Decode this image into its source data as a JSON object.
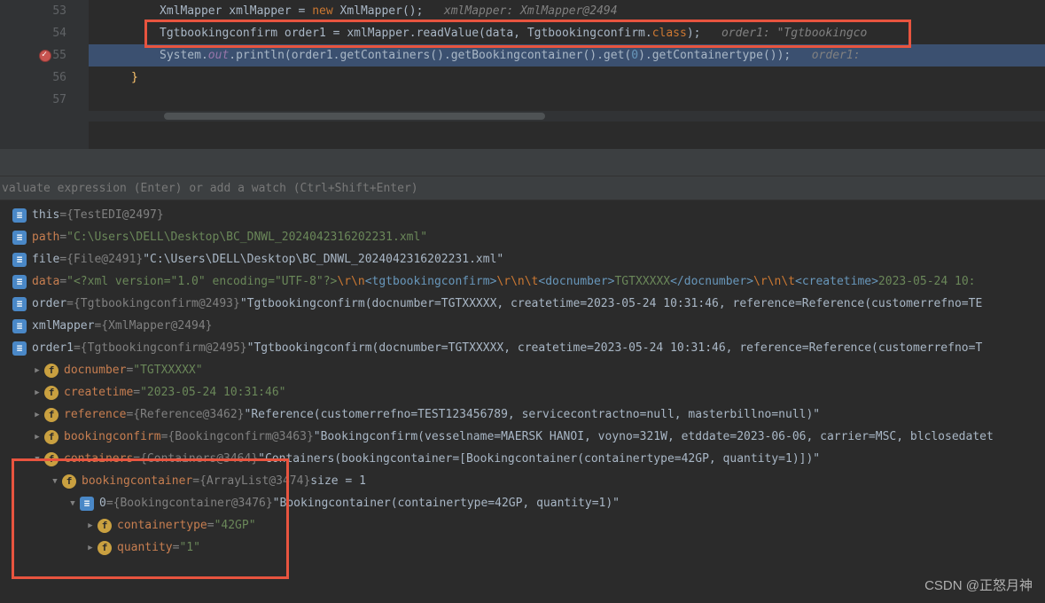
{
  "editor": {
    "lines": {
      "53": {
        "num": "53",
        "text_a": "XmlMapper xmlMapper = ",
        "kw_new": "new",
        "text_b": " XmlMapper();",
        "hint": "   xmlMapper: XmlMapper@2494"
      },
      "54": {
        "num": "54",
        "text_a": "Tgtbookingconfirm order1 = xmlMapper.readValue(data, Tgtbookingconfirm.",
        "kw_class": "class",
        "text_b": ");",
        "hint": "   order1: \"Tgtbookingco"
      },
      "55": {
        "num": "55",
        "text_a": "System.",
        "field": "out",
        "text_b": ".println(order1.getContainers().getBookingcontainer().get(",
        "arg": "0",
        "text_c": ").getContainertype());",
        "hint": "   order1:"
      },
      "56": {
        "num": "56",
        "brace": "}"
      },
      "57": {
        "num": "57"
      }
    }
  },
  "eval_placeholder": "valuate expression (Enter) or add a watch (Ctrl+Shift+Enter)",
  "vars": {
    "this": {
      "name": "this",
      "ref": "{TestEDI@2497}"
    },
    "path": {
      "name": "path",
      "val": "\"C:\\Users\\DELL\\Desktop\\BC_DNWL_2024042316202231.xml\""
    },
    "file": {
      "name": "file",
      "ref": "{File@2491}",
      "str": " \"C:\\Users\\DELL\\Desktop\\BC_DNWL_2024042316202231.xml\""
    },
    "data": {
      "name": "data",
      "prefix": "\"<?xml version=\"1.0\" encoding=\"UTF-8\"?>",
      "esc1": "\\r\\n",
      "tag1": "<tgtbookingconfirm>",
      "esc2": "\\r\\n\\t",
      "tag2": "<docnumber>",
      "content": "TGTXXXXX",
      "tag3": "</docnumber>",
      "esc3": "\\r\\n\\t",
      "tag4": "<createtime>",
      "suffix": "2023-05-24 10:"
    },
    "order": {
      "name": "order",
      "ref": "{Tgtbookingconfirm@2493}",
      "str": " \"Tgtbookingconfirm(docnumber=TGTXXXXX, createtime=2023-05-24 10:31:46, reference=Reference(customerrefno=TE"
    },
    "xmlMapper": {
      "name": "xmlMapper",
      "ref": "{XmlMapper@2494}"
    },
    "order1": {
      "name": "order1",
      "ref": "{Tgtbookingconfirm@2495}",
      "str": " \"Tgtbookingconfirm(docnumber=TGTXXXXX, createtime=2023-05-24 10:31:46, reference=Reference(customerrefno=T"
    },
    "docnumber": {
      "name": "docnumber",
      "val": "\"TGTXXXXX\""
    },
    "createtime": {
      "name": "createtime",
      "val": "\"2023-05-24 10:31:46\""
    },
    "reference": {
      "name": "reference",
      "ref": "{Reference@3462}",
      "str": " \"Reference(customerrefno=TEST123456789, servicecontractno=null, masterbillno=null)\""
    },
    "bookingconfirm": {
      "name": "bookingconfirm",
      "ref": "{Bookingconfirm@3463}",
      "str": " \"Bookingconfirm(vesselname=MAERSK HANOI, voyno=321W, etddate=2023-06-06, carrier=MSC, blclosedatet"
    },
    "containers": {
      "name": "containers",
      "ref": "{Containers@3464}",
      "str": " \"Containers(bookingcontainer=[Bookingcontainer(containertype=42GP, quantity=1)])\""
    },
    "bookingcontainer": {
      "name": "bookingcontainer",
      "ref": "{ArrayList@3474}",
      "size": "  size = 1"
    },
    "item0": {
      "name": "0",
      "ref": "{Bookingcontainer@3476}",
      "str": " \"Bookingcontainer(containertype=42GP, quantity=1)\""
    },
    "containertype": {
      "name": "containertype",
      "val": "\"42GP\""
    },
    "quantity": {
      "name": "quantity",
      "val": "\"1\""
    }
  },
  "watermark": "CSDN @正怒月神"
}
